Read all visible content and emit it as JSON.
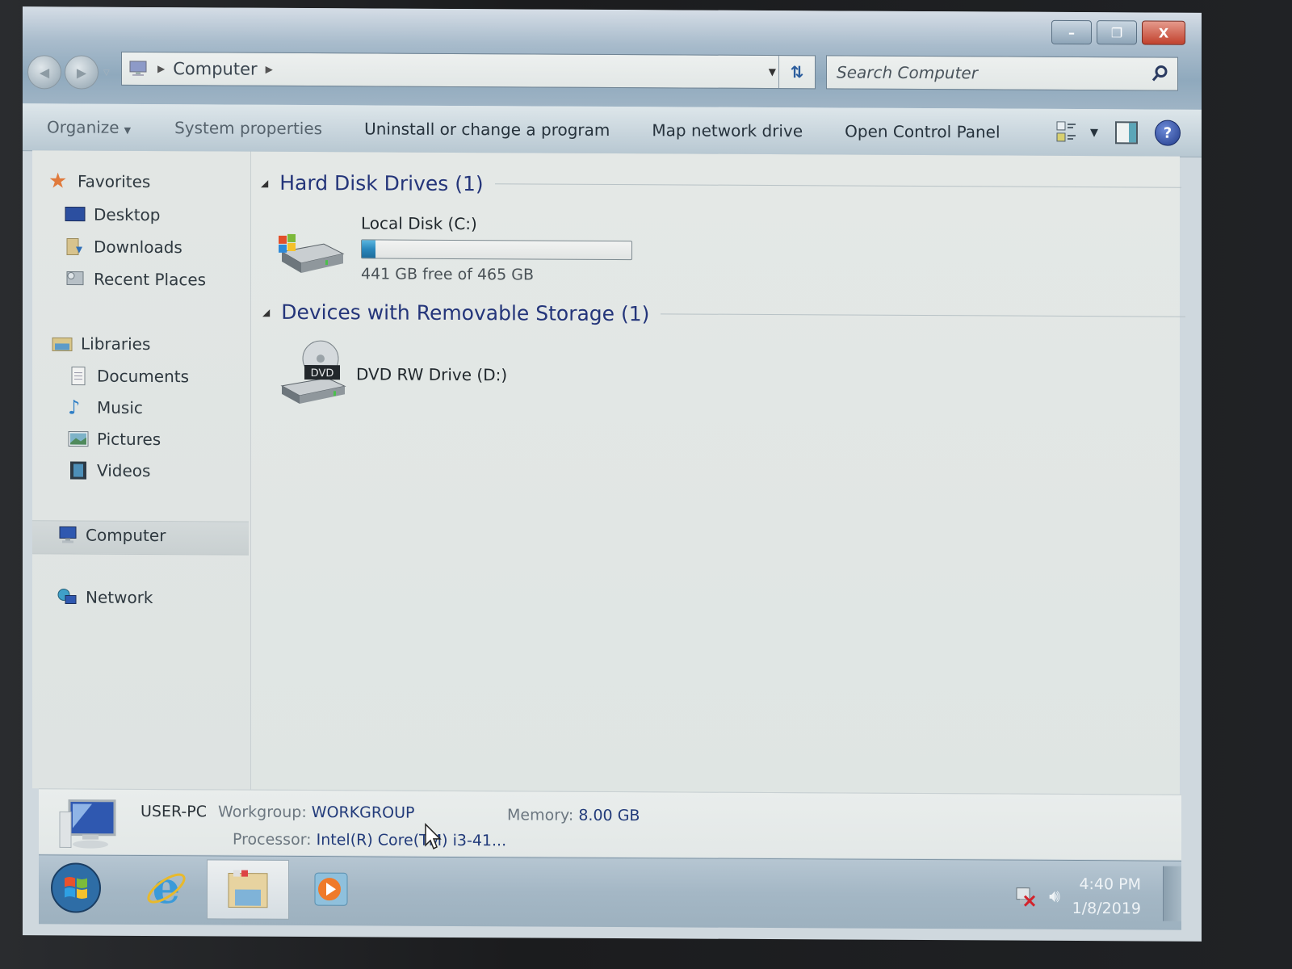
{
  "window": {
    "controls": {
      "minimize": "–",
      "restore": "❐",
      "close": "X"
    },
    "nav": {
      "back_icon": "back-arrow-icon",
      "forward_icon": "forward-arrow-icon",
      "recent_icon": "chevron-down-icon"
    },
    "address": {
      "breadcrumbs": [
        "Computer"
      ],
      "dropdown_icon": "▼",
      "refresh_icon": "↻"
    },
    "search": {
      "placeholder": "Search Computer",
      "value": ""
    }
  },
  "toolbar": {
    "organize": "Organize",
    "items": [
      "System properties",
      "Uninstall or change a program",
      "Map network drive",
      "Open Control Panel"
    ],
    "help_label": "?"
  },
  "sidebar": {
    "favorites": {
      "label": "Favorites",
      "items": [
        {
          "label": "Desktop",
          "icon": "desktop-icon"
        },
        {
          "label": "Downloads",
          "icon": "downloads-icon"
        },
        {
          "label": "Recent Places",
          "icon": "recent-places-icon"
        }
      ]
    },
    "libraries": {
      "label": "Libraries",
      "items": [
        {
          "label": "Documents",
          "icon": "documents-icon"
        },
        {
          "label": "Music",
          "icon": "music-icon"
        },
        {
          "label": "Pictures",
          "icon": "pictures-icon"
        },
        {
          "label": "Videos",
          "icon": "videos-icon"
        }
      ]
    },
    "computer": {
      "label": "Computer",
      "selected": true
    },
    "network": {
      "label": "Network"
    }
  },
  "content": {
    "groups": [
      {
        "label": "Hard Disk Drives (1)",
        "drives": [
          {
            "name": "Local Disk (C:)",
            "free_text": "441 GB free of 465 GB",
            "free_gb": 441,
            "total_gb": 465,
            "used_fraction": 0.052
          }
        ]
      },
      {
        "label": "Devices with Removable Storage (1)",
        "drives": [
          {
            "name": "DVD RW Drive (D:)",
            "badge": "DVD"
          }
        ]
      }
    ]
  },
  "details": {
    "computer_name": "USER-PC",
    "workgroup_label": "Workgroup:",
    "workgroup_value": "WORKGROUP",
    "memory_label": "Memory:",
    "memory_value": "8.00 GB",
    "processor_label": "Processor:",
    "processor_value": "Intel(R) Core(TM) i3-41..."
  },
  "taskbar": {
    "pinned": [
      "start-button",
      "internet-explorer",
      "windows-explorer",
      "media-player"
    ],
    "clock_time": "4:40 PM",
    "clock_date": "1/8/2019"
  },
  "colors": {
    "group_header": "#24357a",
    "progress_fill": "#2a87bc",
    "close_button": "#c1412d"
  }
}
